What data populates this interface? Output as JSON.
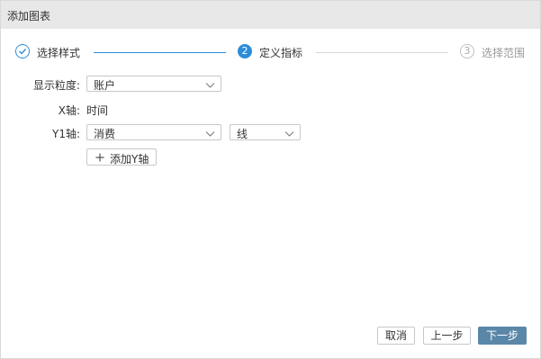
{
  "dialog": {
    "title": "添加图表"
  },
  "stepper": {
    "steps": [
      {
        "number": "1",
        "label": "选择样式",
        "state": "done"
      },
      {
        "number": "2",
        "label": "定义指标",
        "state": "active"
      },
      {
        "number": "3",
        "label": "选择范围",
        "state": "pending"
      }
    ],
    "active_color": "#2d8cd8",
    "pending_color": "#bfbfbf"
  },
  "form": {
    "granularity": {
      "label": "显示粒度:",
      "value": "账户"
    },
    "x_axis": {
      "label": "X轴:",
      "value": "时间"
    },
    "y1_axis": {
      "label": "Y1轴:",
      "metric_value": "消费",
      "chart_type_value": "线"
    },
    "add_y_axis": {
      "label": "添加Y轴"
    }
  },
  "footer": {
    "cancel_label": "取消",
    "prev_label": "上一步",
    "next_label": "下一步",
    "primary_color": "#5a87a8"
  }
}
